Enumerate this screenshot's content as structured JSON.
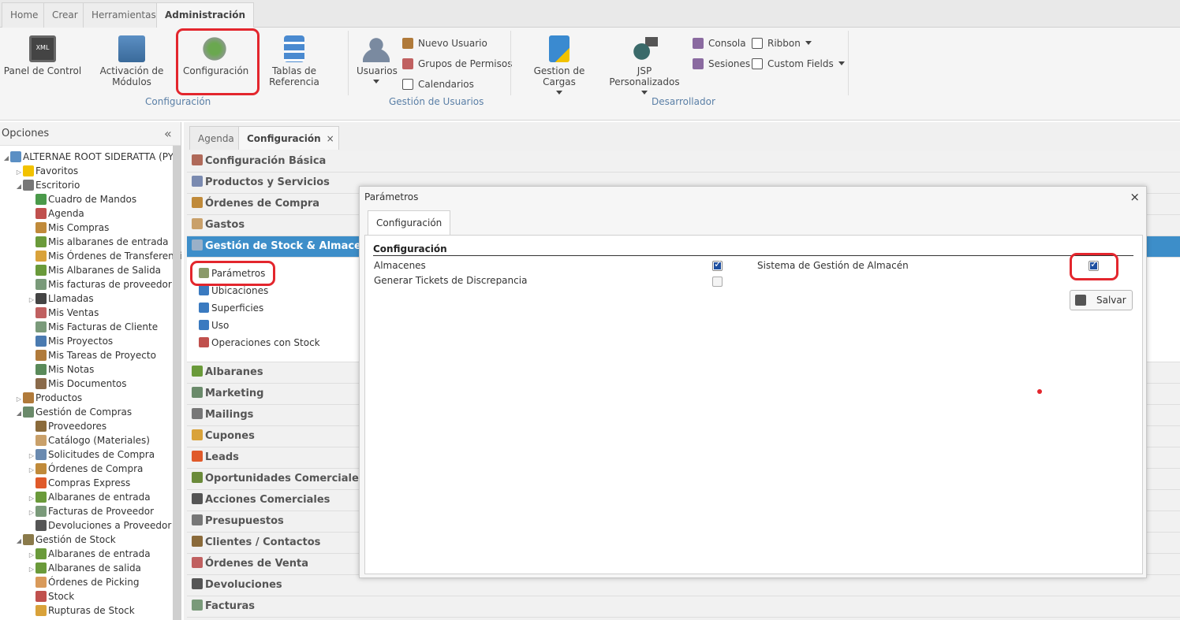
{
  "ribbon_tabs": [
    "Home",
    "Crear",
    "Herramientas",
    "Administración"
  ],
  "ribbon": {
    "config_group": {
      "label": "Configuración",
      "buttons": [
        "Panel de Control",
        "Activación de Módulos",
        "Configuración",
        "Tablas de Referencia"
      ]
    },
    "users_group": {
      "label": "Gestión de Usuarios",
      "usuarios": "Usuarios",
      "small": [
        "Nuevo Usuario",
        "Grupos de Permisos",
        "Calendarios"
      ]
    },
    "dev_group": {
      "label": "Desarrollador",
      "buttons": [
        "Gestion de Cargas",
        "JSP Personalizados"
      ],
      "small": [
        "Consola",
        "Sesiones",
        "Ribbon",
        "Custom Fields"
      ]
    }
  },
  "left_panel": {
    "title": "Opciones",
    "tree": [
      {
        "label": "ALTERNAE ROOT SIDERATTA (PYE",
        "level": 0,
        "toggle": "◢",
        "icon_color": "#5b8fc4"
      },
      {
        "label": "Favoritos",
        "level": 1,
        "toggle": "▷",
        "icon_color": "#f2c200"
      },
      {
        "label": "Escritorio",
        "level": 1,
        "toggle": "◢",
        "icon_color": "#777777"
      },
      {
        "label": "Cuadro de Mandos",
        "level": 2,
        "toggle": "",
        "icon_color": "#4a9a4a"
      },
      {
        "label": "Agenda",
        "level": 2,
        "toggle": "",
        "icon_color": "#c0504d"
      },
      {
        "label": "Mis Compras",
        "level": 2,
        "toggle": "",
        "icon_color": "#c08a3a"
      },
      {
        "label": "Mis albaranes de entrada",
        "level": 2,
        "toggle": "",
        "icon_color": "#6a9a3a"
      },
      {
        "label": "Mis Órdenes de Transferenci",
        "level": 2,
        "toggle": "",
        "icon_color": "#d9a23a"
      },
      {
        "label": "Mis Albaranes de Salida",
        "level": 2,
        "toggle": "",
        "icon_color": "#6a9a3a"
      },
      {
        "label": "Mis facturas de proveedor",
        "level": 2,
        "toggle": "",
        "icon_color": "#7a9a7a"
      },
      {
        "label": "Llamadas",
        "level": 2,
        "toggle": "▷",
        "icon_color": "#444444"
      },
      {
        "label": "Mis Ventas",
        "level": 2,
        "toggle": "",
        "icon_color": "#c06060"
      },
      {
        "label": "Mis Facturas de Cliente",
        "level": 2,
        "toggle": "",
        "icon_color": "#7a9a7a"
      },
      {
        "label": "Mis Proyectos",
        "level": 2,
        "toggle": "",
        "icon_color": "#4a7ab0"
      },
      {
        "label": "Mis Tareas de Proyecto",
        "level": 2,
        "toggle": "",
        "icon_color": "#b07a3a"
      },
      {
        "label": "Mis Notas",
        "level": 2,
        "toggle": "",
        "icon_color": "#5a8a5a"
      },
      {
        "label": "Mis Documentos",
        "level": 2,
        "toggle": "",
        "icon_color": "#8a6a4a"
      },
      {
        "label": "Productos",
        "level": 1,
        "toggle": "▷",
        "icon_color": "#b07a3a"
      },
      {
        "label": "Gestión de Compras",
        "level": 1,
        "toggle": "◢",
        "icon_color": "#6a8a6a"
      },
      {
        "label": "Proveedores",
        "level": 2,
        "toggle": "",
        "icon_color": "#8a6a3a"
      },
      {
        "label": "Catálogo (Materiales)",
        "level": 2,
        "toggle": "",
        "icon_color": "#c9a06a"
      },
      {
        "label": "Solicitudes de Compra",
        "level": 2,
        "toggle": "▷",
        "icon_color": "#6a8ab0"
      },
      {
        "label": "Órdenes de Compra",
        "level": 2,
        "toggle": "▷",
        "icon_color": "#c08a3a"
      },
      {
        "label": "Compras Express",
        "level": 2,
        "toggle": "",
        "icon_color": "#e05a2a"
      },
      {
        "label": "Albaranes de entrada",
        "level": 2,
        "toggle": "▷",
        "icon_color": "#6a9a3a"
      },
      {
        "label": "Facturas de Proveedor",
        "level": 2,
        "toggle": "▷",
        "icon_color": "#7a9a7a"
      },
      {
        "label": "Devoluciones a Proveedor",
        "level": 2,
        "toggle": "",
        "icon_color": "#555555"
      },
      {
        "label": "Gestión de Stock",
        "level": 1,
        "toggle": "◢",
        "icon_color": "#8a7a4a"
      },
      {
        "label": "Albaranes de entrada",
        "level": 2,
        "toggle": "▷",
        "icon_color": "#6a9a3a"
      },
      {
        "label": "Albaranes de salida",
        "level": 2,
        "toggle": "▷",
        "icon_color": "#6a9a3a"
      },
      {
        "label": "Órdenes de Picking",
        "level": 2,
        "toggle": "",
        "icon_color": "#d99a5a"
      },
      {
        "label": "Stock",
        "level": 2,
        "toggle": "",
        "icon_color": "#c0504d"
      },
      {
        "label": "Rupturas de Stock",
        "level": 2,
        "toggle": "",
        "icon_color": "#d9a23a"
      }
    ]
  },
  "center_tabs": {
    "agenda": "Agenda",
    "config": "Configuración",
    "close": "×"
  },
  "accordion": {
    "top": [
      "Configuración Básica",
      "Productos y Servicios",
      "Órdenes de Compra",
      "Gastos"
    ],
    "selected": "Gestión de Stock & Almacenes",
    "sub_items": [
      "Parámetros",
      "Ubicaciones",
      "Superficies",
      "Uso",
      "Operaciones con Stock"
    ],
    "bottom": [
      "Albaranes",
      "Marketing",
      "Mailings",
      "Cupones",
      "Leads",
      "Oportunidades Comerciales",
      "Acciones Comerciales",
      "Presupuestos",
      "Clientes / Contactos",
      "Órdenes de Venta",
      "Devoluciones",
      "Facturas"
    ]
  },
  "dialog": {
    "title": "Parámetros",
    "close": "×",
    "tab": "Configuración",
    "section": "Configuración",
    "fields": {
      "almacenes": {
        "label": "Almacenes",
        "checked": true
      },
      "tickets": {
        "label": "Generar Tickets de Discrepancia",
        "checked": false
      },
      "sga": {
        "label": "Sistema de Gestión de Almacén",
        "checked": true
      }
    },
    "save": "Salvar"
  },
  "colors": {
    "accent": "#3d8ec9",
    "highlight": "#e3262d",
    "group_label": "#5a7fa6"
  }
}
